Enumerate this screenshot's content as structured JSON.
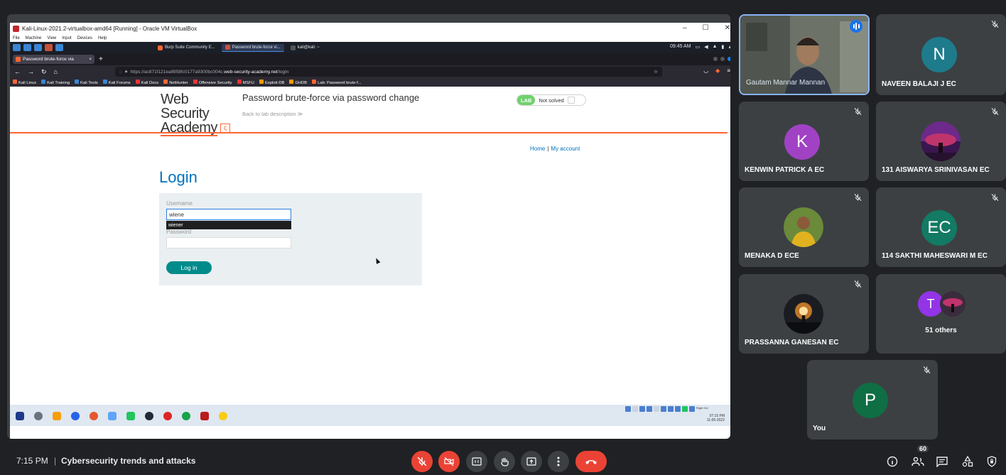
{
  "vm": {
    "title": "Kali-Linux-2021.2-virtualbox-amd64 [Running] - Oracle VM VirtualBox",
    "menu": [
      "File",
      "Machine",
      "View",
      "Input",
      "Devices",
      "Help"
    ],
    "window_controls": [
      "–",
      "☐",
      "✕"
    ]
  },
  "kali": {
    "tasks": [
      "Burp Suite Community E...",
      "Password brute-force vi...",
      "kali@kali: ~"
    ],
    "clock": "09:45 AM"
  },
  "browser": {
    "tab_title": "Password brute-force via",
    "url_prefix": "https://ac871f121ea8958fc0177a9300bc004c.",
    "url_domain": "web-security-academy.net",
    "url_path": "/login",
    "bookmarks": [
      "Kali Linux",
      "Kali Training",
      "Kali Tools",
      "Kali Forums",
      "Kali Docs",
      "NetHunter",
      "Offensive Security",
      "MSFU",
      "Exploit-DB",
      "GHDB",
      "Lab: Password brute-f..."
    ]
  },
  "lab": {
    "logo_line1": "Web Security",
    "logo_line2": "Academy",
    "title": "Password brute-force via password change",
    "back": "Back to lab description  ≫",
    "lab_badge": "LAB",
    "status": "Not solved",
    "nav_home": "Home",
    "nav_sep": "|",
    "nav_account": "My account",
    "heading": "Login",
    "username_label": "Username",
    "username_value": "wiene",
    "autocomplete": "wiener",
    "password_label": "Password",
    "login_button": "Log in"
  },
  "win_taskbar": {
    "time": "07:15 PM",
    "date": "11-05-2022",
    "right_ctrl": "Right Ctrl"
  },
  "participants": [
    {
      "name": "Gautam Mannar Mannan",
      "speaking": true
    },
    {
      "name": "NAVEEN BALAJI J EC",
      "initial": "N",
      "color": "#1e7b8c"
    },
    {
      "name": "KENWIN PATRICK A EC",
      "initial": "K",
      "color": "#a142c4"
    },
    {
      "name": "131 AISWARYA SRINIVASAN EC"
    },
    {
      "name": "MENAKA D ECE"
    },
    {
      "name": "114 SAKTHI MAHESWARI M EC",
      "initial": "EC",
      "color": "#137a63"
    },
    {
      "name": "PRASSANNA GANESAN EC"
    },
    {
      "name": "51 others",
      "initial": "T",
      "color": "#9334e6"
    },
    {
      "name": "You",
      "initial": "P",
      "color": "#0f6e44"
    }
  ],
  "bottom": {
    "time": "7:15 PM",
    "separator": "|",
    "meeting_title": "Cybersecurity trends and attacks",
    "people_count": "60"
  }
}
